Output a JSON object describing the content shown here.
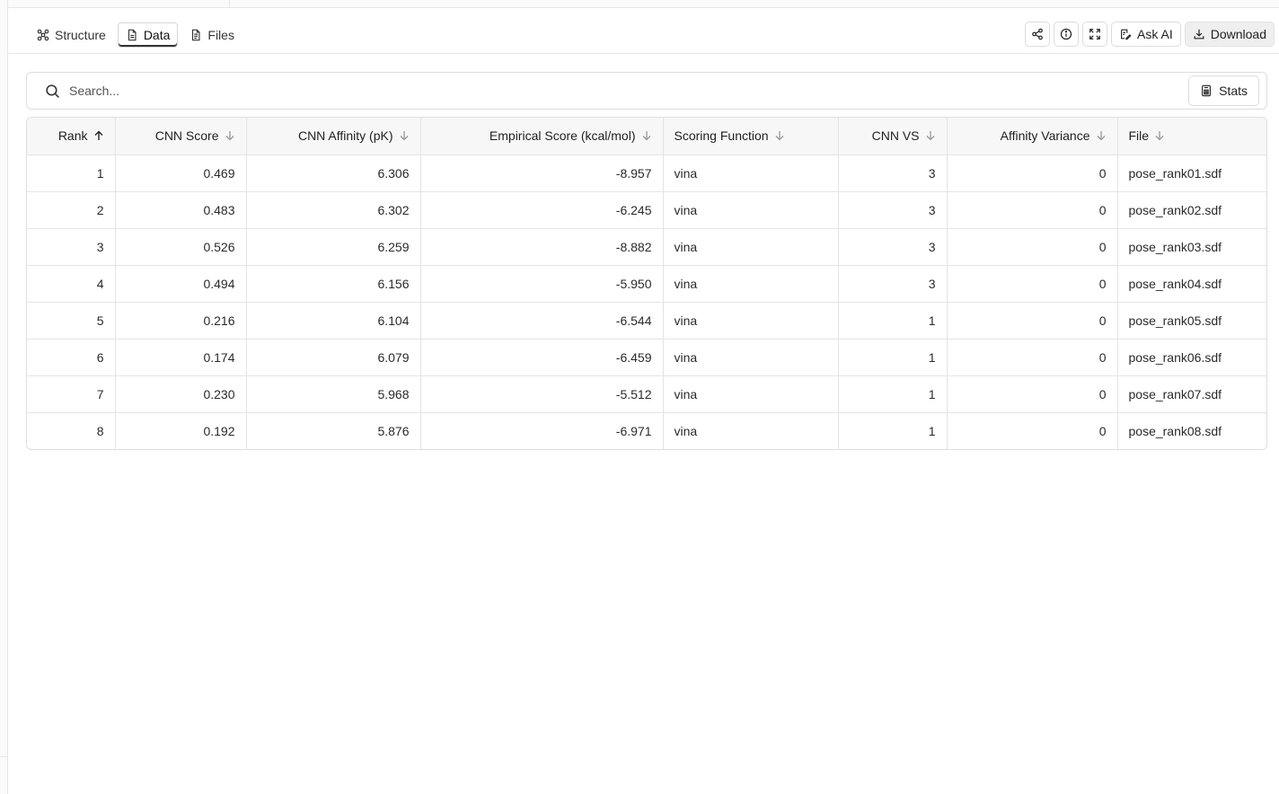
{
  "tabs": [
    {
      "label": "Structure",
      "icon": "structure-icon",
      "active": false
    },
    {
      "label": "Data",
      "icon": "document-icon",
      "active": true
    },
    {
      "label": "Files",
      "icon": "files-icon",
      "active": false
    }
  ],
  "actions": {
    "share_icon": "share-icon",
    "info_icon": "info-icon",
    "expand_icon": "expand-icon",
    "ask_ai_label": "Ask AI",
    "download_label": "Download"
  },
  "search": {
    "placeholder": "Search..."
  },
  "stats_label": "Stats",
  "table": {
    "columns": [
      {
        "label": "Rank",
        "sort": "asc"
      },
      {
        "label": "CNN Score",
        "sort": "desc"
      },
      {
        "label": "CNN Affinity (pK)",
        "sort": "desc"
      },
      {
        "label": "Empirical Score (kcal/mol)",
        "sort": "desc"
      },
      {
        "label": "Scoring Function",
        "sort": "desc"
      },
      {
        "label": "CNN VS",
        "sort": "desc"
      },
      {
        "label": "Affinity Variance",
        "sort": "desc"
      },
      {
        "label": "File",
        "sort": "desc"
      }
    ],
    "rows": [
      [
        "1",
        "0.469",
        "6.306",
        "-8.957",
        "vina",
        "3",
        "0",
        "pose_rank01.sdf"
      ],
      [
        "2",
        "0.483",
        "6.302",
        "-6.245",
        "vina",
        "3",
        "0",
        "pose_rank02.sdf"
      ],
      [
        "3",
        "0.526",
        "6.259",
        "-8.882",
        "vina",
        "3",
        "0",
        "pose_rank03.sdf"
      ],
      [
        "4",
        "0.494",
        "6.156",
        "-5.950",
        "vina",
        "3",
        "0",
        "pose_rank04.sdf"
      ],
      [
        "5",
        "0.216",
        "6.104",
        "-6.544",
        "vina",
        "1",
        "0",
        "pose_rank05.sdf"
      ],
      [
        "6",
        "0.174",
        "6.079",
        "-6.459",
        "vina",
        "1",
        "0",
        "pose_rank06.sdf"
      ],
      [
        "7",
        "0.230",
        "5.968",
        "-5.512",
        "vina",
        "1",
        "0",
        "pose_rank07.sdf"
      ],
      [
        "8",
        "0.192",
        "5.876",
        "-6.971",
        "vina",
        "1",
        "0",
        "pose_rank08.sdf"
      ]
    ]
  }
}
